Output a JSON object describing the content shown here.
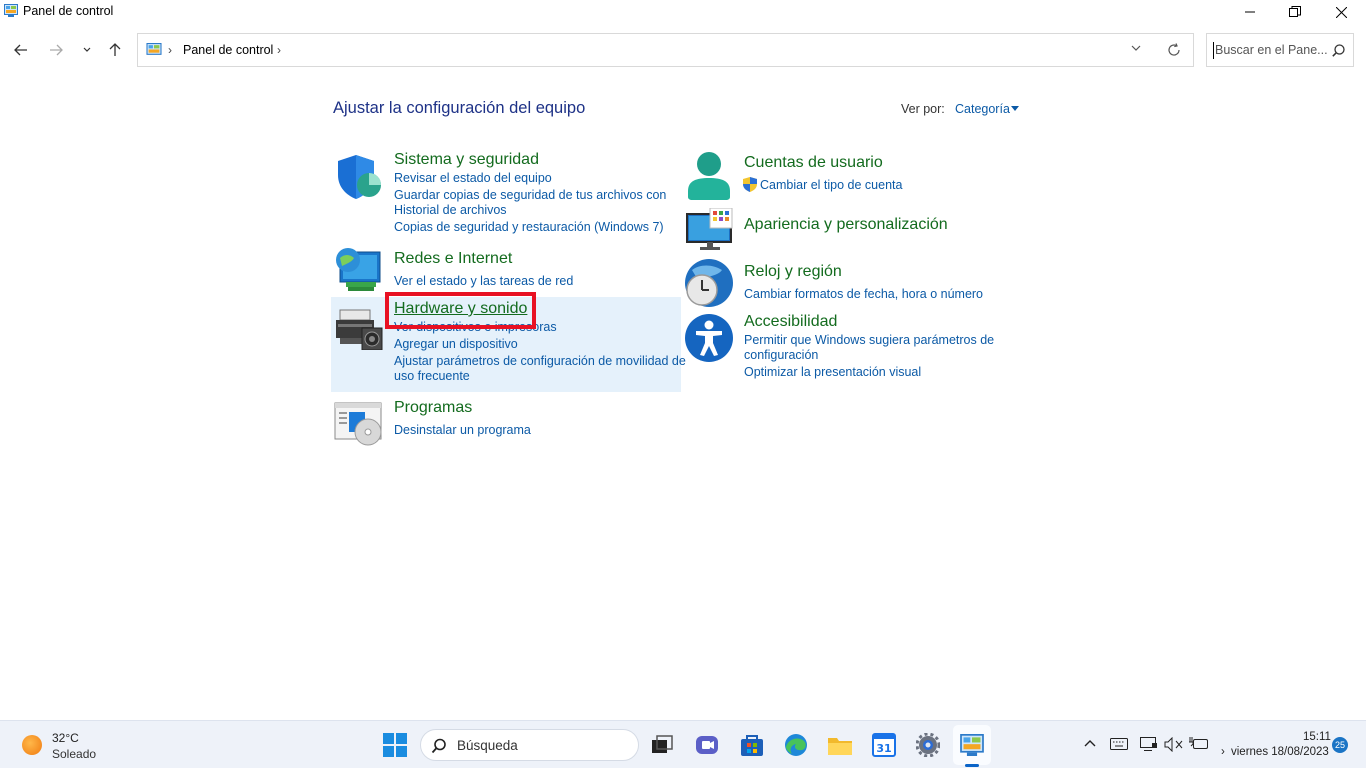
{
  "window": {
    "title": "Panel de control"
  },
  "address": {
    "crumb": "Panel de control",
    "sep": "›"
  },
  "search": {
    "placeholder": "Buscar en el Pane..."
  },
  "main": {
    "heading": "Ajustar la configuración del equipo",
    "view_by_label": "Ver por:",
    "view_by_value": "Categoría"
  },
  "categories": {
    "system": {
      "title": "Sistema y seguridad",
      "links": [
        "Revisar el estado del equipo",
        "Guardar copias de seguridad de tus archivos con",
        "Historial de archivos",
        "Copias de seguridad y restauración (Windows 7)"
      ]
    },
    "network": {
      "title": "Redes e Internet",
      "links": [
        "Ver el estado y las tareas de red"
      ]
    },
    "hardware": {
      "title": "Hardware y sonido",
      "links": [
        "Ver dispositivos e impresoras",
        "Agregar un dispositivo",
        "Ajustar parámetros de configuración de movilidad de",
        "uso frecuente"
      ]
    },
    "programs": {
      "title": "Programas",
      "links": [
        "Desinstalar un programa"
      ]
    },
    "users": {
      "title": "Cuentas de usuario",
      "links": [
        "Cambiar el tipo de cuenta"
      ]
    },
    "appearance": {
      "title": "Apariencia y personalización",
      "links": []
    },
    "clock": {
      "title": "Reloj y región",
      "links": [
        "Cambiar formatos de fecha, hora o número"
      ]
    },
    "access": {
      "title": "Accesibilidad",
      "links": [
        "Permitir que Windows sugiera parámetros de",
        "configuración",
        "Optimizar la presentación visual"
      ]
    }
  },
  "taskbar": {
    "weather_temp": "32°C",
    "weather_desc": "Soleado",
    "search_label": "Búsqueda",
    "time": "15:11",
    "date": "viernes 18/08/2023",
    "notification_count": "25",
    "tray_chevron": "›"
  },
  "colors": {
    "title_green": "#136b1e",
    "link_blue": "#0c5aa6",
    "heading_blue": "#1e3287",
    "highlight": "#e5f1fb",
    "red_box": "#e81123"
  }
}
